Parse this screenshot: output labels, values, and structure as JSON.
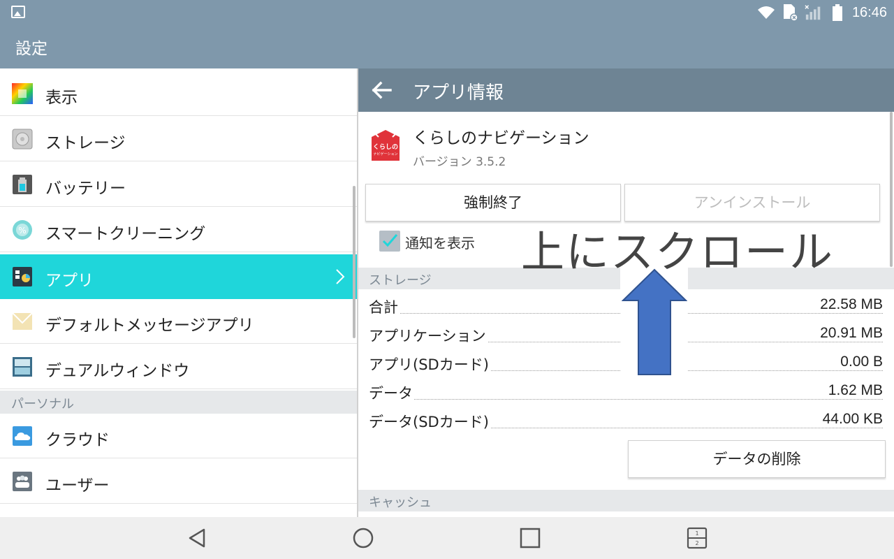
{
  "status_bar": {
    "time": "16:46"
  },
  "title_bar": {
    "title": "設定"
  },
  "menu": {
    "items": [
      {
        "label": "表示"
      },
      {
        "label": "ストレージ"
      },
      {
        "label": "バッテリー"
      },
      {
        "label": "スマートクリーニング"
      },
      {
        "label": "アプリ"
      },
      {
        "label": "デフォルトメッセージアプリ"
      },
      {
        "label": "デュアルウィンドウ"
      }
    ],
    "section_personal": "パーソナル",
    "personal_items": [
      {
        "label": "クラウド"
      },
      {
        "label": "ユーザー"
      }
    ]
  },
  "app_info": {
    "header_title": "アプリ情報",
    "app_name": "くらしのナビゲーション",
    "version": "バージョン 3.5.2",
    "icon_text": "くらしの",
    "icon_subtext": "ナビゲーション",
    "force_stop": "強制終了",
    "uninstall": "アンインストール",
    "show_notifications": "通知を表示",
    "storage_section": "ストレージ",
    "storage_rows": [
      {
        "label": "合計",
        "value": "22.58 MB"
      },
      {
        "label": "アプリケーション",
        "value": "20.91 MB"
      },
      {
        "label": "アプリ(SDカード)",
        "value": "0.00 B"
      },
      {
        "label": "データ",
        "value": "1.62 MB"
      },
      {
        "label": "データ(SDカード)",
        "value": "44.00 KB"
      }
    ],
    "clear_data": "データの削除",
    "cache_section": "キャッシュ"
  },
  "annotation": {
    "text": "上にスクロール",
    "arrow_color": "#4472c4"
  },
  "colors": {
    "status_bar": "#7f98ab",
    "detail_header": "#6e8494",
    "active_item": "#1fd6da"
  }
}
